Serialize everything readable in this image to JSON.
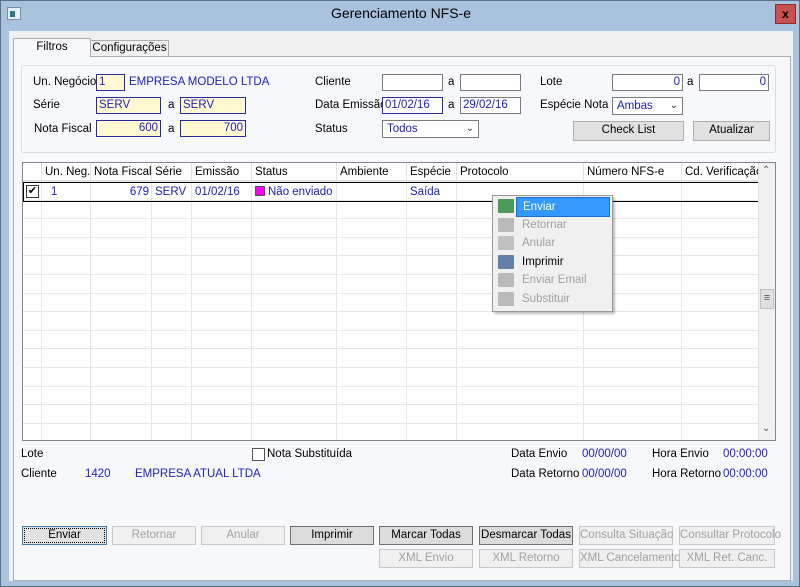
{
  "window": {
    "title": "Gerenciamento NFS-e",
    "close_label": "x"
  },
  "tabs": [
    {
      "label": "Filtros",
      "active": true
    },
    {
      "label": "Configurações",
      "active": false
    }
  ],
  "filters": {
    "un_negocio": {
      "label": "Un. Negócio",
      "value": "1",
      "name": "EMPRESA MODELO LTDA"
    },
    "serie": {
      "label": "Série",
      "from": "SERV",
      "to": "SERV"
    },
    "nota_fiscal": {
      "label": "Nota Fiscal",
      "from": "600",
      "to": "700"
    },
    "cliente": {
      "label": "Cliente",
      "from": "",
      "to": ""
    },
    "data_emissao": {
      "label": "Data Emissão",
      "from": "01/02/16",
      "to": "29/02/16"
    },
    "status": {
      "label": "Status",
      "value": "Todos"
    },
    "lote": {
      "label": "Lote",
      "from": "0",
      "to": "0"
    },
    "especie_nota": {
      "label": "Espécie Nota",
      "value": "Ambas"
    },
    "range_sep": "a",
    "check_list_label": "Check List",
    "atualizar_label": "Atualizar"
  },
  "grid": {
    "columns": [
      "Un. Neg.",
      "Nota Fiscal",
      "Série",
      "Emissão",
      "Status",
      "Ambiente",
      "Espécie",
      "Protocolo",
      "Número NFS-e",
      "Cd. Verificação"
    ],
    "rows": [
      {
        "checked": true,
        "un_neg": "1",
        "nota_fiscal": "679",
        "serie": "SERV",
        "emissao": "01/02/16",
        "status": "Não enviado",
        "status_color": "#ff00ff",
        "ambiente": "",
        "especie": "Saída",
        "protocolo": "",
        "numero": "",
        "cd_verificacao": ""
      }
    ]
  },
  "context_menu": [
    {
      "label": "Enviar",
      "icon": "send-icon",
      "enabled": true,
      "highlighted": true
    },
    {
      "label": "Retornar",
      "icon": "return-icon",
      "enabled": false
    },
    {
      "label": "Anular",
      "icon": "cancel-doc-icon",
      "enabled": false
    },
    {
      "label": "Imprimir",
      "icon": "printer-icon",
      "enabled": true
    },
    {
      "label": "Enviar Email",
      "icon": "email-icon",
      "enabled": false
    },
    {
      "label": "Substituir",
      "icon": "replace-icon",
      "enabled": false
    }
  ],
  "details": {
    "lote_label": "Lote",
    "nota_substituida_label": "Nota Substituída",
    "nota_substituida_checked": false,
    "cliente_label": "Cliente",
    "cliente_code": "1420",
    "cliente_name": "EMPRESA ATUAL LTDA",
    "data_envio_label": "Data Envio",
    "data_envio": "00/00/00",
    "hora_envio_label": "Hora Envio",
    "hora_envio": "00:00:00",
    "data_retorno_label": "Data Retorno",
    "data_retorno": "00/00/00",
    "hora_retorno_label": "Hora Retorno",
    "hora_retorno": "00:00:00"
  },
  "buttons": {
    "enviar": "Enviar",
    "retornar": "Retornar",
    "anular": "Anular",
    "imprimir": "Imprimir",
    "marcar_todas": "Marcar Todas",
    "desmarcar_todas": "Desmarcar Todas",
    "consulta_situacao": "Consulta Situação",
    "consultar_protocolo": "Consultar Protocolo",
    "xml_envio": "XML Envio",
    "xml_retorno": "XML Retorno",
    "xml_cancelamento": "XML Cancelamento",
    "xml_ret_canc": "XML Ret. Canc."
  }
}
